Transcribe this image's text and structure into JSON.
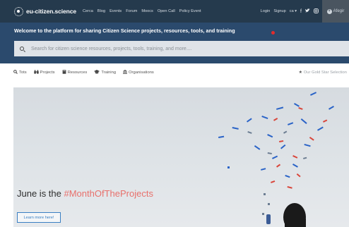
{
  "brand": {
    "name": "eu-citizen.science"
  },
  "topnav": {
    "items": [
      "Cerca",
      "Blog",
      "Events",
      "Forum",
      "Moocs",
      "Open Call",
      "Policy Event"
    ],
    "login": "Login",
    "signup": "Signup",
    "language": "ca ▾",
    "social": [
      "facebook-icon",
      "twitter-icon",
      "instagram-icon"
    ],
    "add_label": "Afegir"
  },
  "welcome": {
    "title": "Welcome to the platform for sharing Citizen Science projects, resources, tools, and training"
  },
  "search": {
    "placeholder": "Search for citizen science resources, projects, tools, training, and more...."
  },
  "tabs": [
    {
      "label": "Tots",
      "icon": "search-icon"
    },
    {
      "label": "Projects",
      "icon": "binoculars-icon"
    },
    {
      "label": "Resources",
      "icon": "book-icon"
    },
    {
      "label": "Training",
      "icon": "graduation-cap-icon"
    },
    {
      "label": "Organisations",
      "icon": "building-icon"
    }
  ],
  "gold_star": {
    "label": "Our Gold Star Selection",
    "icon": "star-icon"
  },
  "hero": {
    "title_prefix": "June is the ",
    "hashtag": "#MonthOfTheProjects",
    "button": "Learn more here!",
    "hashtag_color": "#e8706c"
  },
  "colors": {
    "topbar": "#253a4d",
    "band": "#2b4a6d",
    "accent_dot": "#e32c2c",
    "link": "#3a7fc2"
  }
}
